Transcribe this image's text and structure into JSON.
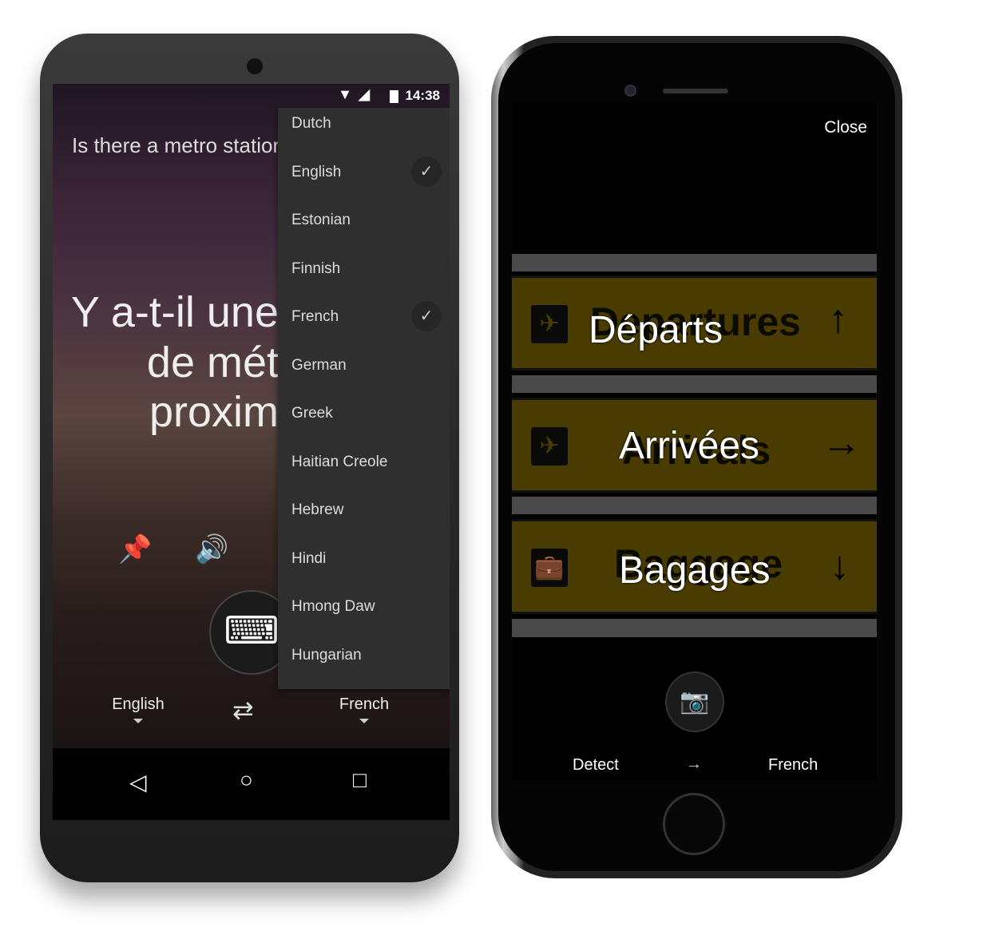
{
  "android": {
    "status_time": "14:38",
    "source_text": "Is there a metro station",
    "translation_lines": [
      "Y a-t-il une",
      "de mét",
      "proxim"
    ],
    "menu_items": [
      {
        "label": "Dutch",
        "checked": false
      },
      {
        "label": "English",
        "checked": true
      },
      {
        "label": "Estonian",
        "checked": false
      },
      {
        "label": "Finnish",
        "checked": false
      },
      {
        "label": "French",
        "checked": true
      },
      {
        "label": "German",
        "checked": false
      },
      {
        "label": "Greek",
        "checked": false
      },
      {
        "label": "Haitian Creole",
        "checked": false
      },
      {
        "label": "Hebrew",
        "checked": false
      },
      {
        "label": "Hindi",
        "checked": false
      },
      {
        "label": "Hmong Daw",
        "checked": false
      },
      {
        "label": "Hungarian",
        "checked": false
      }
    ],
    "from_lang": "English",
    "to_lang": "French",
    "icons": {
      "pin": "📌",
      "speaker": "🔊",
      "keyboard": "⌨",
      "swap": "⇄",
      "back": "◁",
      "home": "○",
      "recents": "□",
      "check": "✓"
    }
  },
  "iphone": {
    "close_label": "Close",
    "signs": [
      {
        "original": "Departures",
        "translated": "Départs",
        "icon": "✈",
        "arrow": "↑"
      },
      {
        "original": "Arrivals",
        "translated": "Arrivées",
        "icon": "✈",
        "arrow": "→"
      },
      {
        "original": "Baggage",
        "translated": "Bagages",
        "icon": "💼",
        "arrow": "↓"
      }
    ],
    "from_lang": "Detect",
    "arrow": "→",
    "to_lang": "French",
    "camera_icon": "📷"
  },
  "colors": {
    "sign_yellow": "#4a3c00",
    "menu_bg": "#2f2f2f"
  }
}
